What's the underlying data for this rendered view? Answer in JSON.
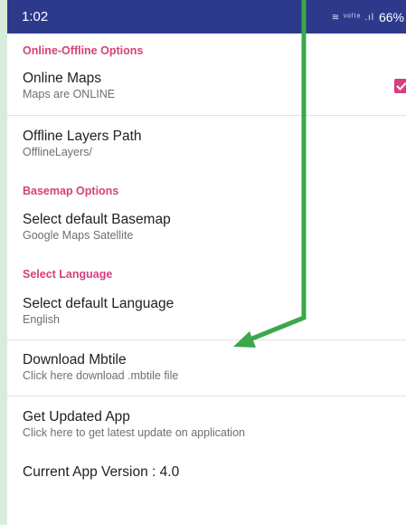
{
  "status_bar": {
    "time": "1:02",
    "network_icons": "≋ ᵛᵒˡᵗᵉ .ıl",
    "battery": "66%"
  },
  "sections": {
    "online_offline": "Online-Offline Options",
    "basemap": "Basemap Options",
    "language": "Select Language"
  },
  "prefs": {
    "online_maps": {
      "title": "Online Maps",
      "summary": "Maps are ONLINE",
      "checked": true
    },
    "offline_layers": {
      "title": "Offline Layers Path",
      "summary": "OfflineLayers/"
    },
    "basemap": {
      "title": "Select default Basemap",
      "summary": "Google Maps Satellite"
    },
    "language": {
      "title": "Select default Language",
      "summary": "English"
    },
    "download": {
      "title": "Download Mbtile",
      "summary": "Click here download .mbtile file"
    },
    "update": {
      "title": "Get Updated App",
      "summary": "Click here to get latest update on application"
    },
    "version": {
      "title": "Current App Version : 4.0"
    }
  },
  "colors": {
    "accent": "#d63f7b",
    "status_bar": "#2d3a8c",
    "arrow": "#3aa84a"
  },
  "annotation": {
    "type": "arrow",
    "icon": "green-arrow-icon"
  }
}
